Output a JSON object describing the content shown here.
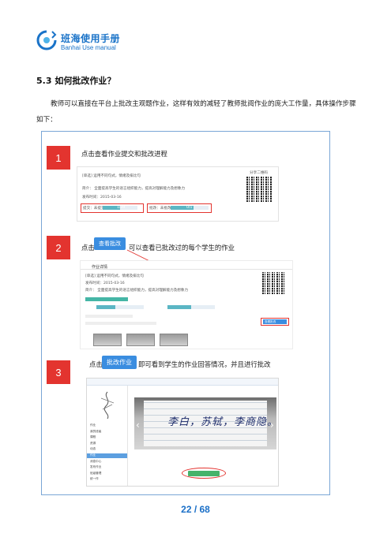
{
  "header": {
    "title": "班海使用手册",
    "subtitle": "Banhai Use manual",
    "brand_color": "#1a73c8"
  },
  "section": {
    "heading": "5.3 如何批改作业？",
    "intro": "教师可以直接在平台上批改主观题作业，这样有效的减轻了教师批阅作业的庞大工作量，具体操作步骤如下："
  },
  "steps": [
    {
      "number": "1",
      "text": "点击查看作业提交和批改进程"
    },
    {
      "number": "2",
      "text_before": "点击",
      "chip": "查看批改",
      "text_after": "可以查看已批改过的每个学生的作业"
    },
    {
      "number": "3",
      "text_before": "点击",
      "chip": "批改作业",
      "text_after": "即可看到学生的作业回答情况，并且进行批改"
    }
  ],
  "shot1": {
    "line1": "[单选]  运用不同句式，情绪及排比句",
    "line2": "简介：   全面提高学生的语言组织能力，提高对理解能力及想象力",
    "line3": "发布时间：2015-03-16",
    "progress": [
      {
        "label": "提交：未提交",
        "value_text": "1/39",
        "fraction": 0.5
      },
      {
        "label": "批改：未批改",
        "value_text": "0/1",
        "fraction": 0.6
      }
    ],
    "qr_caption": "分享二维码"
  },
  "shot2": {
    "tab": "作业详情",
    "line1": "[单选]  运用不同句式，情绪及排比句",
    "line2": "发布时间：2015-03-16",
    "line3": "简介：   全面提高学生的语言组织能力，提高对理解能力及想象力",
    "button": "查看批改"
  },
  "shot3": {
    "nav_items": [
      "作业",
      "我的班级",
      "课程",
      "资源",
      "动态",
      "作业",
      "消息中心",
      "发布作业",
      "班级管理",
      "统一作"
    ],
    "active_index": 5,
    "handwriting": "李白，苏轼，李商隐。"
  },
  "footer": {
    "page": "22 / 68"
  },
  "colors": {
    "step_red": "#e3342f",
    "frame_border": "#7aa6d6",
    "chip_blue": "#3a8de0",
    "page_number": "#1a6fc7"
  }
}
